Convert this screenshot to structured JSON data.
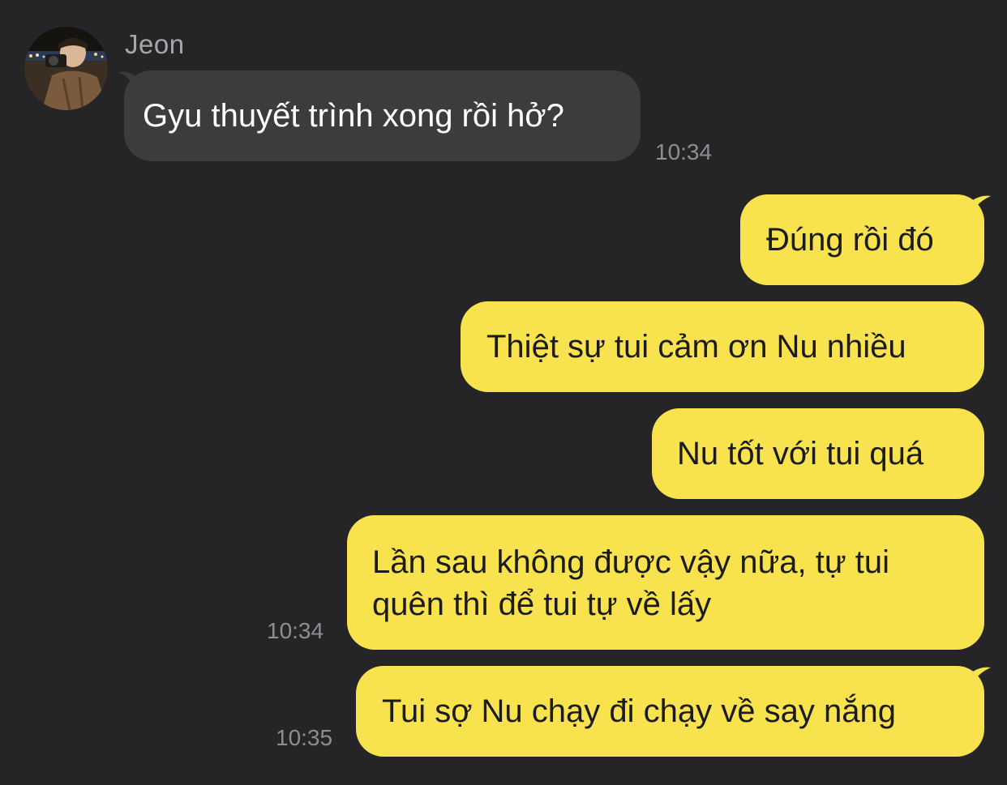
{
  "conversation": {
    "contact_name": "Jeon",
    "messages": [
      {
        "direction": "incoming",
        "text": "Gyu thuyết trình xong rồi hở?",
        "time": "10:34"
      },
      {
        "direction": "outgoing",
        "text": "Đúng rồi đó"
      },
      {
        "direction": "outgoing",
        "text": "Thiệt sự tui cảm ơn Nu nhiều"
      },
      {
        "direction": "outgoing",
        "text": "Nu tốt với tui quá"
      },
      {
        "direction": "outgoing",
        "lines": [
          "Lần sau không được vậy nữa, tự tui",
          "quên thì để tui tự về lấy"
        ],
        "time": "10:34"
      },
      {
        "direction": "outgoing",
        "text": "Tui sợ Nu chạy đi chạy về say nắng",
        "time": "10:35"
      }
    ]
  },
  "colors": {
    "background": "#252527",
    "incoming_bubble": "#3c3c3e",
    "outgoing_bubble": "#f8e34e",
    "timestamp": "#8e8e92"
  }
}
